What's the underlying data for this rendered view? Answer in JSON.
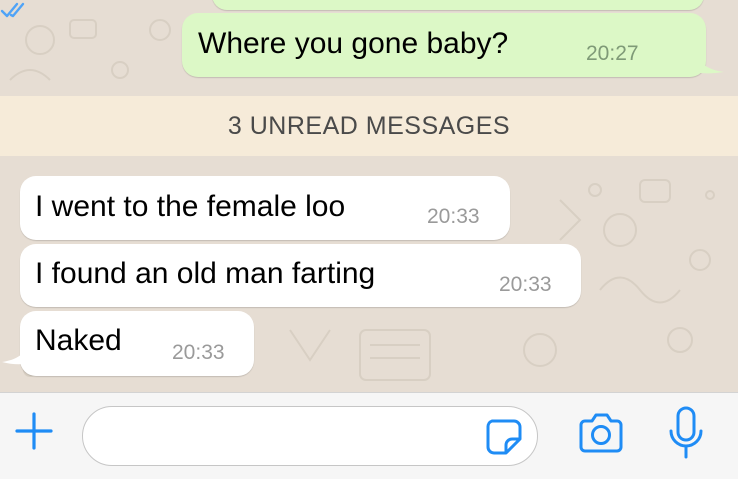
{
  "messages": {
    "outgoing": {
      "text": "Where you gone baby?",
      "time": "20:27",
      "status_icon": "double-check-read-icon"
    },
    "unread_divider": "3 UNREAD MESSAGES",
    "incoming": [
      {
        "text": "I went to the female loo",
        "time": "20:33"
      },
      {
        "text": "I found an old man farting",
        "time": "20:33"
      },
      {
        "text": "Naked",
        "time": "20:33"
      }
    ]
  },
  "composer": {
    "value": "",
    "placeholder": "",
    "icons": [
      "plus-icon",
      "sticker-icon",
      "camera-icon",
      "microphone-icon"
    ]
  },
  "colors": {
    "accent": "#1f8cf5",
    "outgoing_bubble": "#dcf8c6",
    "incoming_bubble": "#ffffff",
    "unread_bar": "#f6ebd9",
    "chat_background": "#e6ddd3"
  }
}
